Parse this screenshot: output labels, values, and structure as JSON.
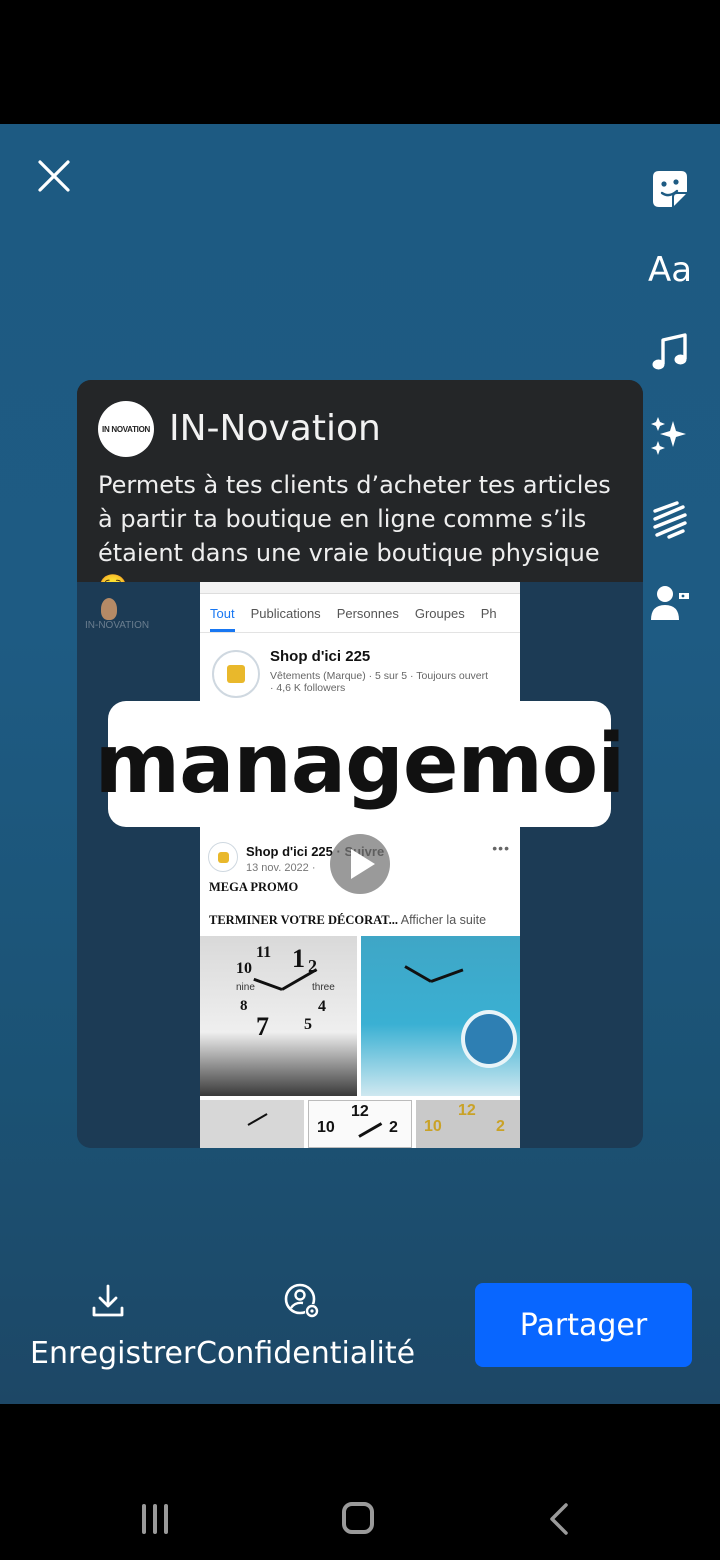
{
  "editor": {
    "tools": [
      {
        "name": "sticker-icon"
      },
      {
        "name": "text-tool-icon",
        "label": "Aa"
      },
      {
        "name": "music-icon"
      },
      {
        "name": "effects-sparkle-icon"
      },
      {
        "name": "drawing-squiggle-icon"
      },
      {
        "name": "tag-people-icon"
      }
    ]
  },
  "card": {
    "avatar_text": "IN NOVATION",
    "page_name": "IN-Novation",
    "post_text": "Permets à tes clients d’acheter tes articles à partir ta boutique en ligne comme s’ils étaient dans une vraie boutique physique ☺️...",
    "watermark": "IN-NOVATION"
  },
  "screenshot": {
    "tabs": [
      "Tout",
      "Publications",
      "Personnes",
      "Groupes",
      "Ph"
    ],
    "shop": {
      "name": "Shop d'ici 225",
      "meta_line1": "Vêtements (Marque) · 5 sur 5 · Toujours ouvert",
      "meta_line2": "· 4,6 K followers"
    },
    "post": {
      "author": "Shop d'ici 225 · Suivre",
      "date": "13 nov. 2022 · ",
      "line1": "MEGA PROMO",
      "line2": "TERMINER VOTRE DÉCORAT...",
      "more": " Afficher la suite"
    }
  },
  "sticker_text": "managemoi",
  "actions": {
    "save_label": "Enregistrer",
    "privacy_label": "Confidentialité",
    "share_label": "Partager"
  },
  "colors": {
    "editor_bg": "#1e5b83",
    "share_button": "#0866ff",
    "fb_blue": "#1877f2"
  }
}
